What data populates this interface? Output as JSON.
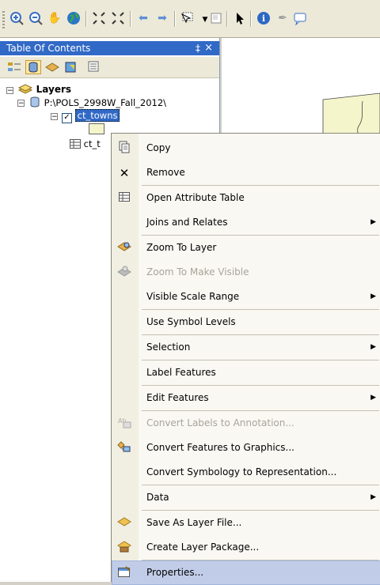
{
  "toolbar": {
    "icons": [
      "zoom-in-icon",
      "zoom-out-icon",
      "pan-hand-icon",
      "globe-icon",
      "fixed-zoom-in-icon",
      "fixed-zoom-out-icon",
      "back-arrow-icon",
      "forward-arrow-icon",
      "select-features-icon",
      "clear-selection-icon",
      "pointer-icon",
      "identify-icon",
      "edit-pencil-icon",
      "html-popup-icon"
    ]
  },
  "toc": {
    "title": "Table Of Contents",
    "pin": "‡",
    "close": "×",
    "layers_label": "Layers",
    "data_frame_path": "P:\\POLS_2998W_Fall_2012\\",
    "layer_name": "ct_towns",
    "table_name": "ct_t"
  },
  "context_menu": {
    "items": [
      {
        "label": "Copy",
        "icon": "copy-icon",
        "enabled": true
      },
      {
        "label": "Remove",
        "icon": "remove-icon",
        "enabled": true
      },
      {
        "label": "Open Attribute Table",
        "icon": "table-icon",
        "enabled": true
      },
      {
        "label": "Joins and Relates",
        "icon": "",
        "enabled": true,
        "submenu": true
      },
      {
        "label": "Zoom To Layer",
        "icon": "zoom-layer-icon",
        "enabled": true
      },
      {
        "label": "Zoom To Make Visible",
        "icon": "zoom-visible-icon",
        "enabled": false
      },
      {
        "label": "Visible Scale Range",
        "icon": "",
        "enabled": true,
        "submenu": true
      },
      {
        "label": "Use Symbol Levels",
        "icon": "",
        "enabled": true
      },
      {
        "label": "Selection",
        "icon": "",
        "enabled": true,
        "submenu": true
      },
      {
        "label": "Label Features",
        "icon": "",
        "enabled": true
      },
      {
        "label": "Edit Features",
        "icon": "",
        "enabled": true,
        "submenu": true
      },
      {
        "label": "Convert Labels to Annotation...",
        "icon": "convert-labels-icon",
        "enabled": false
      },
      {
        "label": "Convert Features to Graphics...",
        "icon": "convert-graphics-icon",
        "enabled": true
      },
      {
        "label": "Convert Symbology to Representation...",
        "icon": "",
        "enabled": true
      },
      {
        "label": "Data",
        "icon": "",
        "enabled": true,
        "submenu": true
      },
      {
        "label": "Save As Layer File...",
        "icon": "layer-file-icon",
        "enabled": true
      },
      {
        "label": "Create Layer Package...",
        "icon": "layer-package-icon",
        "enabled": true
      },
      {
        "label": "Properties...",
        "icon": "properties-icon",
        "enabled": true,
        "selected": true
      }
    ]
  },
  "colors": {
    "title_bar": "#3169c6",
    "menu_highlight": "#c1cde8",
    "polygon_fill": "#f5f5cc"
  }
}
